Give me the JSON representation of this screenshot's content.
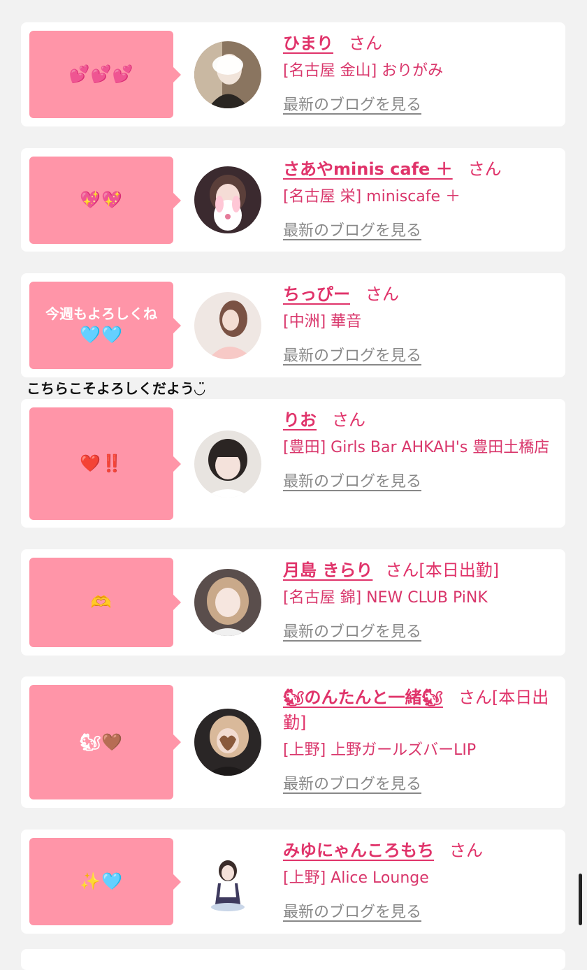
{
  "cards": [
    {
      "bubble_text": "",
      "bubble_emoji": "💕💕💕",
      "name": "ひまり",
      "san": "さん",
      "shop": "[名古屋 金山] おりがみ",
      "blog_link": "最新のブログを見る"
    },
    {
      "bubble_text": "",
      "bubble_emoji": "💖💖",
      "name": "さあやminis cafe ＋",
      "san": "さん",
      "shop": "[名古屋 栄] miniscafe ＋",
      "blog_link": "最新のブログを見る"
    },
    {
      "bubble_text": "今週もよろしくね",
      "bubble_emoji": "🩵🩵",
      "name": "ちっぴー",
      "san": "さん",
      "shop": "[中洲] 華音",
      "blog_link": "最新のブログを見る"
    },
    {
      "bubble_text": "",
      "bubble_emoji": "❤️‼️",
      "name": "りお",
      "san": "さん",
      "shop": "[豊田] Girls Bar AHKAH's 豊田土橋店",
      "blog_link": "最新のブログを見る"
    },
    {
      "bubble_text": "",
      "bubble_emoji": "🫶",
      "name": "月島 きらり",
      "san": "さん[本日出勤]",
      "shop": "[名古屋 錦] NEW CLUB PiNK",
      "blog_link": "最新のブログを見る"
    },
    {
      "bubble_text": "",
      "bubble_emoji": "🐿🤎",
      "name": "🐿のんたんと一緒🐿",
      "san": "さん[本日出勤]",
      "shop": "[上野] 上野ガールズバーLIP",
      "blog_link": "最新のブログを見る"
    },
    {
      "bubble_text": "",
      "bubble_emoji": "✨🩵",
      "name": "みゆにゃんころもち",
      "san": "さん",
      "shop": "[上野] Alice Lounge",
      "blog_link": "最新のブログを見る"
    }
  ],
  "overlay_text": "こちらこそよろしくだよう◡̈",
  "colors": {
    "bubble": "#ff95a8",
    "name": "#e0336a",
    "link": "#888888",
    "background": "#f2f2f2"
  }
}
